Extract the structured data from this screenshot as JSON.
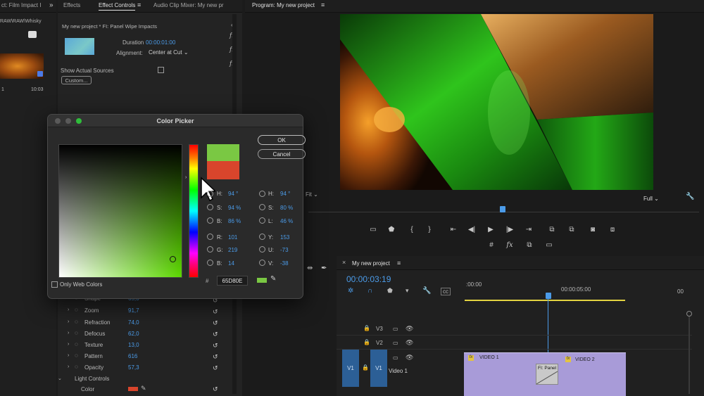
{
  "project_panel": {
    "tab": "ct: Film Impact I",
    "path": "RAW\\RAW\\Whisky",
    "clip_num": "1",
    "clip_time": "10:03"
  },
  "effects_panel": {
    "tabs": [
      "Effects",
      "Effect Controls",
      "Audio Clip Mixer: My new pr"
    ],
    "clip_title": "My new project * FI: Panel Wipe Impacts",
    "duration_label": "Duration",
    "duration_value": "00:00:01:00",
    "alignment_label": "Alignment:",
    "alignment_value": "Center at Cut",
    "show_actual_sources": "Show Actual Sources",
    "custom_button": "Custom...",
    "props": [
      {
        "name": "Shape",
        "value": "65,3"
      },
      {
        "name": "Zoom",
        "value": "91,7"
      },
      {
        "name": "Refraction",
        "value": "74,0"
      },
      {
        "name": "Defocus",
        "value": "62,0"
      },
      {
        "name": "Texture",
        "value": "13,0"
      },
      {
        "name": "Pattern",
        "value": "616"
      },
      {
        "name": "Opacity",
        "value": "57,3"
      }
    ],
    "light_controls": "Light Controls",
    "color_label": "Color"
  },
  "color_picker": {
    "title": "Color Picker",
    "ok": "OK",
    "cancel": "Cancel",
    "only_web_colors": "Only Web Colors",
    "hex": "65D80E",
    "hsb": {
      "h_label": "H:",
      "h": "94 °",
      "s_label": "S:",
      "s": "94 %",
      "b_label": "B:",
      "b": "86 %"
    },
    "rgb": {
      "r_label": "R:",
      "r": "101",
      "g_label": "G:",
      "g": "219",
      "b_label": "B:",
      "b": "14"
    },
    "hsl": {
      "h_label": "H:",
      "h": "94 °",
      "s_label": "S:",
      "s": "80 %",
      "l_label": "L:",
      "l": "46 %"
    },
    "yuv": {
      "y_label": "Y:",
      "y": "153",
      "u_label": "U:",
      "u": "-73",
      "v_label": "V:",
      "v": "-38"
    },
    "new_color": "#7ac843",
    "old_color": "#d9452c",
    "hash": "#"
  },
  "program_monitor": {
    "tab": "Program: My new project",
    "fit": "Fit",
    "quality": "Full"
  },
  "timeline": {
    "tab": "My new project",
    "timecode": "00:00:03:19",
    "ruler_start": ":00:00",
    "ruler_mid": "00:00:05:00",
    "ruler_end": "00",
    "tracks": [
      {
        "name": "V3"
      },
      {
        "name": "V2"
      },
      {
        "name": "V1",
        "label": "Video 1",
        "src": "V1"
      }
    ],
    "clip1": "VIDEO 1",
    "clip2": "VIDEO 2",
    "transition": "FI: Panel",
    "fx": "fx"
  },
  "colors": {
    "accent_blue": "#4b9be8",
    "clip_purple": "#a89bd8",
    "picker_green": "#65D80E"
  }
}
